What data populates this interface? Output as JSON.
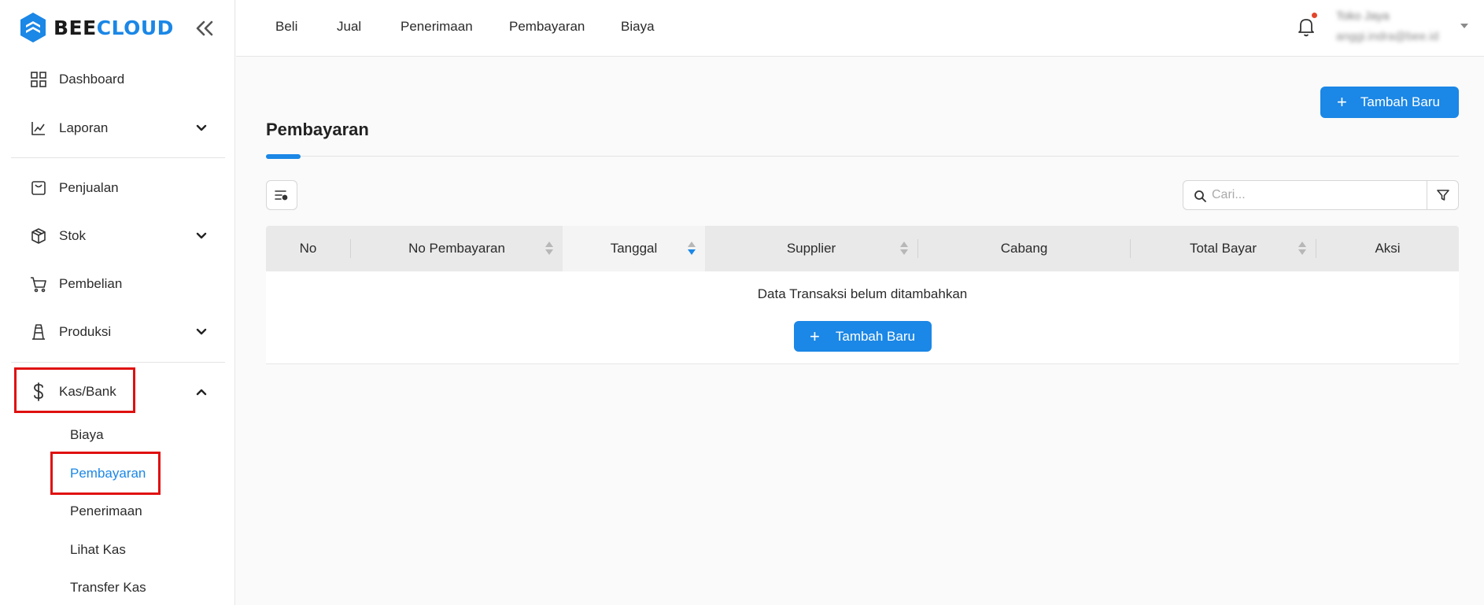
{
  "brand": {
    "part1": "BEE",
    "part2": "CLOUD",
    "accent": "#1b87e6"
  },
  "sidebar": {
    "items": [
      {
        "label": "Dashboard",
        "icon": "grid-icon"
      },
      {
        "label": "Laporan",
        "icon": "chart-line-icon",
        "expandable": true
      },
      {
        "label": "Penjualan",
        "icon": "shopping-bag-icon"
      },
      {
        "label": "Stok",
        "icon": "box-icon",
        "expandable": true
      },
      {
        "label": "Pembelian",
        "icon": "cart-icon"
      },
      {
        "label": "Produksi",
        "icon": "factory-icon",
        "expandable": true
      },
      {
        "label": "Kas/Bank",
        "icon": "dollar-icon",
        "expandable": true,
        "expanded": true
      }
    ],
    "kasbank_sub": [
      {
        "label": "Biaya"
      },
      {
        "label": "Pembayaran",
        "active": true
      },
      {
        "label": "Penerimaan"
      },
      {
        "label": "Lihat Kas"
      },
      {
        "label": "Transfer Kas"
      }
    ]
  },
  "topnav": {
    "items": [
      "Beli",
      "Jual",
      "Penerimaan",
      "Pembayaran",
      "Biaya"
    ]
  },
  "user": {
    "name": "Toko Jaya",
    "email": "anggi.indra@bee.id",
    "notification_dot_color": "#e2452c"
  },
  "page": {
    "title": "Pembayaran",
    "add_button_label": "Tambah Baru",
    "search_placeholder": "Cari..."
  },
  "table": {
    "columns": [
      "No",
      "No Pembayaran",
      "Tanggal",
      "Supplier",
      "Cabang",
      "Total Bayar",
      "Aksi"
    ],
    "sorted_column": "Tanggal",
    "sort_direction": "descending",
    "empty_message": "Data Transaksi belum ditambahkan",
    "empty_add_label": "Tambah Baru"
  },
  "highlight_color": "#e01010"
}
